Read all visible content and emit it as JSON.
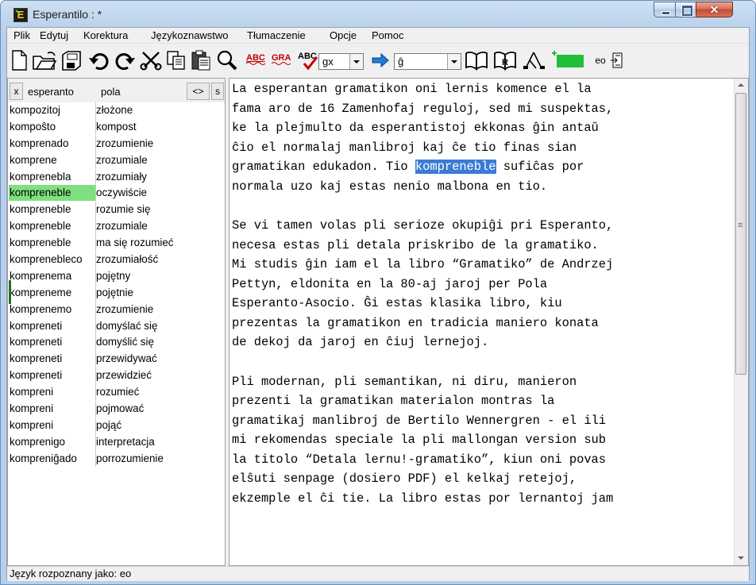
{
  "window": {
    "title": "Esperantilo : *"
  },
  "menu": [
    "Plik",
    "Edytuj",
    "Korektura",
    "Językoznawstwo",
    "Tłumaczenie",
    "Opcje",
    "Pomoc"
  ],
  "toolbar": {
    "icons": [
      "new-file-icon",
      "open-folder-icon",
      "save-icon",
      "undo-icon",
      "redo-icon",
      "cut-icon",
      "copy-icon",
      "paste-icon",
      "search-icon",
      "spellcheck-abc-icon",
      "grammar-gra-icon",
      "abc-check-icon",
      "arrow-right-icon",
      "book-icon",
      "dictionary-book-icon",
      "syntax-tree-icon",
      "green-box-icon",
      "export-icon"
    ],
    "combo1": "gx",
    "combo2": "ĝ",
    "lang_label": "eo"
  },
  "left_panel": {
    "close_label": "x",
    "lang_label": "esperanto",
    "target_label": "pola",
    "swap_label": "<>",
    "s_label": "s",
    "rows": [
      {
        "eo": "kompozitoj",
        "pl": "złożone"
      },
      {
        "eo": "kompoŝto",
        "pl": "kompost"
      },
      {
        "eo": "komprenado",
        "pl": "zrozumienie"
      },
      {
        "eo": "komprene",
        "pl": "zrozumiale"
      },
      {
        "eo": "komprenebla",
        "pl": "zrozumiały"
      },
      {
        "eo": "kompreneble",
        "pl": "oczywiście"
      },
      {
        "eo": "kompreneble",
        "pl": "rozumie się"
      },
      {
        "eo": "kompreneble",
        "pl": "zrozumiale"
      },
      {
        "eo": "kompreneble",
        "pl": "ma się rozumieć"
      },
      {
        "eo": "komprenebleco",
        "pl": "zrozumiałość"
      },
      {
        "eo": "komprenema",
        "pl": "pojętny"
      },
      {
        "eo": "kompreneme",
        "pl": "pojętnie"
      },
      {
        "eo": "komprenemo",
        "pl": "zrozumienie"
      },
      {
        "eo": "kompreneti",
        "pl": "domyślać się"
      },
      {
        "eo": "kompreneti",
        "pl": "domyślić się"
      },
      {
        "eo": "kompreneti",
        "pl": "przewidywać"
      },
      {
        "eo": "kompreneti",
        "pl": "przewidzieć"
      },
      {
        "eo": "kompreni",
        "pl": "rozumieć"
      },
      {
        "eo": "kompreni",
        "pl": "pojmować"
      },
      {
        "eo": "kompreni",
        "pl": "pojąć"
      },
      {
        "eo": "komprenigo",
        "pl": "interpretacja"
      },
      {
        "eo": "kompreniĝado",
        "pl": "porrozumienie"
      }
    ],
    "selected_index": 5
  },
  "editor": {
    "p1": [
      "La esperantan gramatikon oni lernis komence el la",
      "fama aro de 16 Zamenhofaj reguloj, sed mi suspektas,",
      "ke la plejmulto da esperantistoj ekkonas ĝin antaŭ",
      "ĉio el normalaj manlibroj kaj ĉe tio finas sian"
    ],
    "p1_l5_before": "gramatikan edukadon. Tio ",
    "p1_l5_highlight": "kompreneble",
    "p1_l5_after": " sufiĉas por",
    "p1_l6": "normala uzo kaj estas nenio malbona en tio.",
    "p2": [
      "Se vi tamen volas pli serioze okupiĝi pri Esperanto,",
      "necesa estas pli detala priskribo de la gramatiko.",
      "Mi studis ĝin iam el la libro “Gramatiko” de Andrzej",
      "Pettyn, eldonita en la 80-aj jaroj per Pola",
      "Esperanto-Asocio. Ĝi estas klasika libro, kiu",
      "prezentas la gramatikon en tradicia maniero konata",
      "de dekoj da jaroj en ĉiuj lernejoj."
    ],
    "p3": [
      "Pli modernan, pli semantikan, ni diru, manieron",
      "prezenti la gramatikan materialon montras la",
      "gramatikaj manlibroj de Bertilo Wennergren - el ili",
      "mi rekomendas speciale la pli mallongan version sub",
      "la titolo “Detala lernu!-gramatiko”, kiun oni povas",
      "elŝuti senpage (dosiero PDF) el kelkaj retejoj,",
      "ekzemple el ĉi tie. La libro estas por lernantoj jam"
    ]
  },
  "status": {
    "text": "Język rozpoznany jako: eo"
  }
}
